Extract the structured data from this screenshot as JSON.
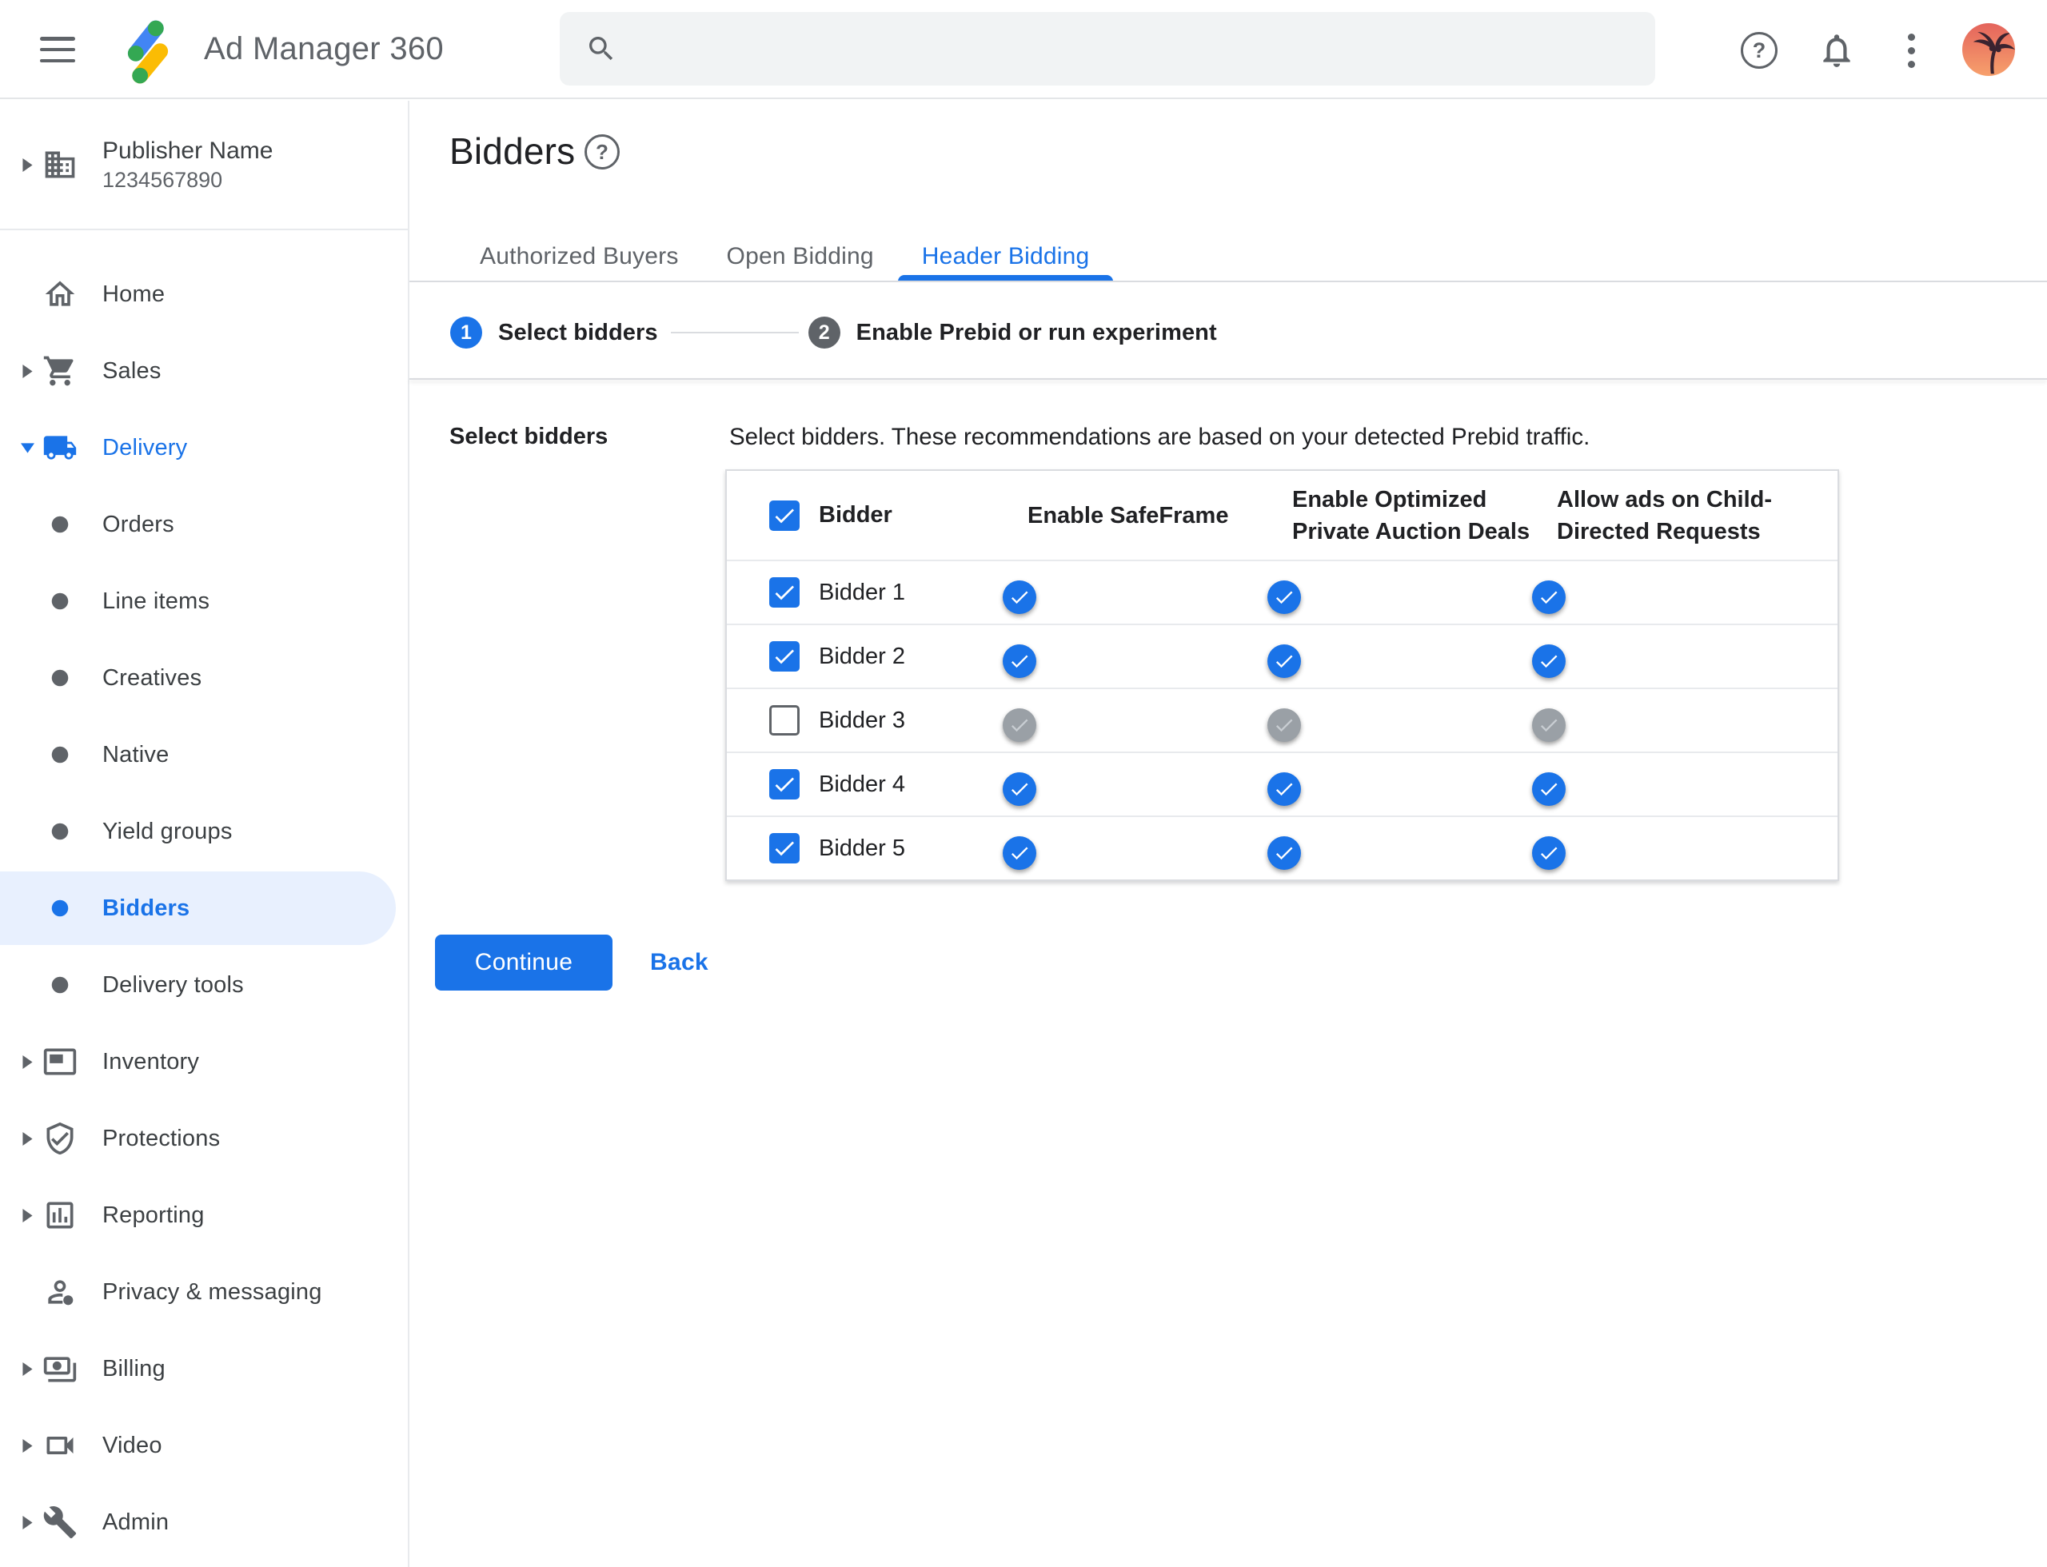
{
  "topbar": {
    "app_title": "Ad Manager 360",
    "search_value": "",
    "icons": [
      "menu-icon",
      "ad-manager-logo",
      "search-icon",
      "help-icon",
      "notifications-icon",
      "more-vert-icon",
      "avatar"
    ]
  },
  "sidebar": {
    "publisher": {
      "name": "Publisher Name",
      "id": "1234567890"
    },
    "items": [
      {
        "id": "home",
        "label": "Home",
        "icon": "home",
        "caret": "none"
      },
      {
        "id": "sales",
        "label": "Sales",
        "icon": "cart",
        "caret": "right"
      },
      {
        "id": "delivery",
        "label": "Delivery",
        "icon": "truck",
        "caret": "down",
        "accent": true
      },
      {
        "id": "orders",
        "label": "Orders",
        "icon": "dot",
        "caret": "none"
      },
      {
        "id": "line-items",
        "label": "Line items",
        "icon": "dot",
        "caret": "none"
      },
      {
        "id": "creatives",
        "label": "Creatives",
        "icon": "dot",
        "caret": "none"
      },
      {
        "id": "native",
        "label": "Native",
        "icon": "dot",
        "caret": "none"
      },
      {
        "id": "yield-groups",
        "label": "Yield groups",
        "icon": "dot",
        "caret": "none"
      },
      {
        "id": "bidders",
        "label": "Bidders",
        "icon": "dot",
        "caret": "none",
        "selected": true
      },
      {
        "id": "delivery-tools",
        "label": "Delivery tools",
        "icon": "dot",
        "caret": "none"
      },
      {
        "id": "inventory",
        "label": "Inventory",
        "icon": "inventory",
        "caret": "right"
      },
      {
        "id": "protections",
        "label": "Protections",
        "icon": "shield",
        "caret": "right"
      },
      {
        "id": "reporting",
        "label": "Reporting",
        "icon": "report",
        "caret": "right"
      },
      {
        "id": "privacy",
        "label": "Privacy & messaging",
        "icon": "privacy",
        "caret": "none"
      },
      {
        "id": "billing",
        "label": "Billing",
        "icon": "billing",
        "caret": "right"
      },
      {
        "id": "video",
        "label": "Video",
        "icon": "video",
        "caret": "right"
      },
      {
        "id": "admin",
        "label": "Admin",
        "icon": "admin",
        "caret": "right"
      }
    ]
  },
  "page": {
    "title": "Bidders",
    "tabs": [
      {
        "id": "authorized-buyers",
        "label": "Authorized Buyers",
        "active": false
      },
      {
        "id": "open-bidding",
        "label": "Open Bidding",
        "active": false
      },
      {
        "id": "header-bidding",
        "label": "Header Bidding",
        "active": true
      }
    ],
    "stepper": [
      {
        "number": "1",
        "label": "Select bidders",
        "state": "active"
      },
      {
        "number": "2",
        "label": "Enable Prebid or run experiment",
        "state": "upcoming"
      }
    ]
  },
  "content": {
    "section_label": "Select bidders",
    "description": "Select bidders. These recommendations are based on your detected Prebid traffic.",
    "table": {
      "header_checkbox_checked": true,
      "columns": [
        "Bidder",
        "Enable SafeFrame",
        "Enable Optimized\nPrivate Auction Deals",
        "Allow ads on Child-\nDirected Requests"
      ],
      "rows": [
        {
          "name": "Bidder 1",
          "checked": true,
          "safeframe": true,
          "optimized_deals": true,
          "child_directed": true
        },
        {
          "name": "Bidder 2",
          "checked": true,
          "safeframe": true,
          "optimized_deals": true,
          "child_directed": true
        },
        {
          "name": "Bidder 3",
          "checked": false,
          "safeframe": false,
          "optimized_deals": false,
          "child_directed": false
        },
        {
          "name": "Bidder 4",
          "checked": true,
          "safeframe": true,
          "optimized_deals": true,
          "child_directed": true
        },
        {
          "name": "Bidder 5",
          "checked": true,
          "safeframe": true,
          "optimized_deals": true,
          "child_directed": true
        }
      ]
    },
    "actions": {
      "continue_label": "Continue",
      "back_label": "Back"
    }
  },
  "colors": {
    "accent_blue": "#1a73e8",
    "toggle_track_on": "#8db3f3",
    "toggle_thumb_off": "#9aa0a6",
    "selected_item_bg": "#e8f0fe",
    "search_bg": "#f1f3f4",
    "divider": "#dadce0",
    "text_primary": "#202124",
    "text_secondary": "#5f6368",
    "logo_blue": "#4285f4",
    "logo_yellow": "#fbbc04",
    "logo_green": "#34a853"
  }
}
